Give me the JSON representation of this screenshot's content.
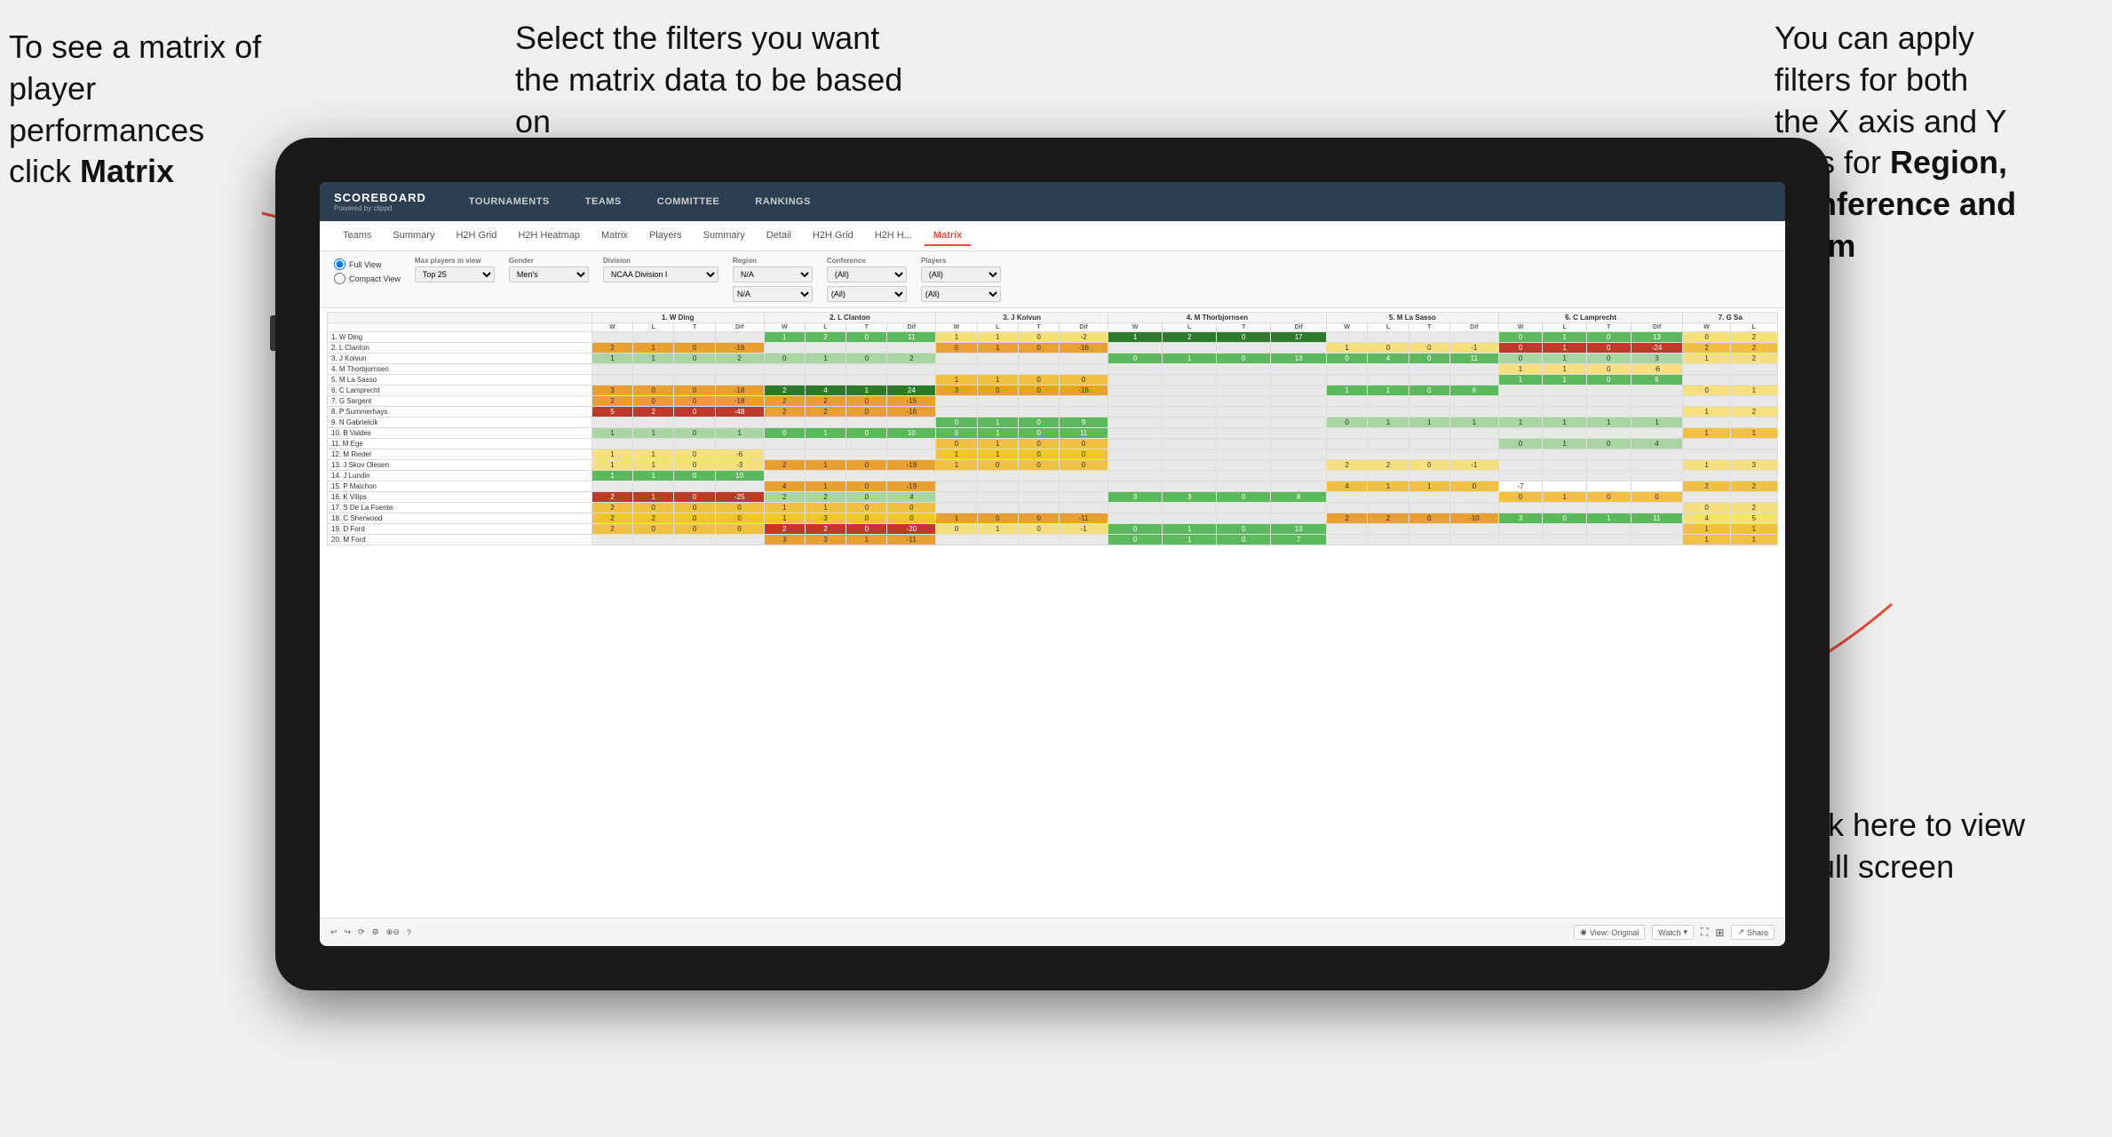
{
  "annotations": {
    "top_left": {
      "line1": "To see a matrix of",
      "line2": "player performances",
      "line3_prefix": "click ",
      "line3_bold": "Matrix"
    },
    "top_center": {
      "text": "Select the filters you want the matrix data to be based on"
    },
    "top_right": {
      "line1": "You  can apply",
      "line2": "filters for both",
      "line3": "the X axis and Y",
      "line4_prefix": "Axis for ",
      "line4_bold": "Region,",
      "line5_bold": "Conference and",
      "line6_bold": "Team"
    },
    "bottom_right": {
      "line1": "Click here to view",
      "line2": "in full screen"
    }
  },
  "nav": {
    "brand": "SCOREBOARD",
    "brand_sub": "Powered by clippd",
    "items": [
      "TOURNAMENTS",
      "TEAMS",
      "COMMITTEE",
      "RANKINGS"
    ]
  },
  "sub_tabs": {
    "tabs": [
      "Teams",
      "Summary",
      "H2H Grid",
      "H2H Heatmap",
      "Matrix",
      "Players",
      "Summary",
      "Detail",
      "H2H Grid",
      "H2H H...",
      "Matrix"
    ],
    "active": "Matrix"
  },
  "filters": {
    "view_options": [
      "Full View",
      "Compact View"
    ],
    "max_players_label": "Max players in view",
    "max_players_value": "Top 25",
    "gender_label": "Gender",
    "gender_value": "Men's",
    "division_label": "Division",
    "division_value": "NCAA Division I",
    "region_label": "Region",
    "region_value1": "N/A",
    "region_value2": "N/A",
    "conference_label": "Conference",
    "conference_value1": "(All)",
    "conference_value2": "(All)",
    "players_label": "Players",
    "players_value1": "(All)",
    "players_value2": "(All)"
  },
  "columns": [
    {
      "num": "1",
      "name": "W Ding"
    },
    {
      "num": "2",
      "name": "L Clanton"
    },
    {
      "num": "3",
      "name": "J Koivun"
    },
    {
      "num": "4",
      "name": "M Thorbjornsen"
    },
    {
      "num": "5",
      "name": "M La Sasso"
    },
    {
      "num": "6",
      "name": "C Lamprecht"
    },
    {
      "num": "7",
      "name": "G Sa"
    }
  ],
  "sub_cols": [
    "W",
    "L",
    "T",
    "Dif"
  ],
  "rows": [
    {
      "num": "1",
      "name": "W Ding"
    },
    {
      "num": "2",
      "name": "L Clanton"
    },
    {
      "num": "3",
      "name": "J Koivun"
    },
    {
      "num": "4",
      "name": "M Thorbjornsen"
    },
    {
      "num": "5",
      "name": "M La Sasso"
    },
    {
      "num": "6",
      "name": "C Lamprecht"
    },
    {
      "num": "7",
      "name": "G Sargent"
    },
    {
      "num": "8",
      "name": "P Summerhays"
    },
    {
      "num": "9",
      "name": "N Gabrielcik"
    },
    {
      "num": "10",
      "name": "B Valdes"
    },
    {
      "num": "11",
      "name": "M Ege"
    },
    {
      "num": "12",
      "name": "M Riedel"
    },
    {
      "num": "13",
      "name": "J Skov Olesen"
    },
    {
      "num": "14",
      "name": "J Lundin"
    },
    {
      "num": "15",
      "name": "P Maichon"
    },
    {
      "num": "16",
      "name": "K Vilips"
    },
    {
      "num": "17",
      "name": "S De La Fuente"
    },
    {
      "num": "18",
      "name": "C Sherwood"
    },
    {
      "num": "19",
      "name": "D Ford"
    },
    {
      "num": "20",
      "name": "M Ford"
    }
  ],
  "bottom_bar": {
    "view_label": "View: Original",
    "watch_label": "Watch",
    "share_label": "Share"
  }
}
